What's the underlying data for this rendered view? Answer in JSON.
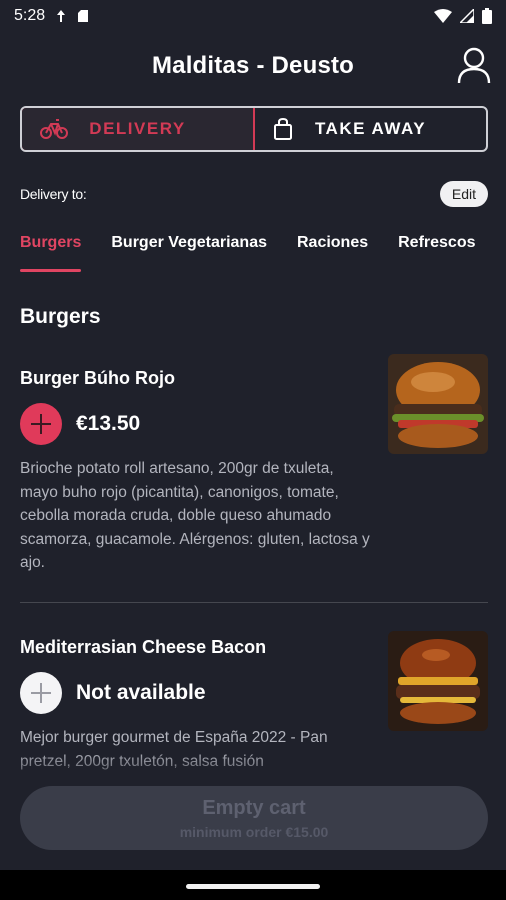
{
  "status": {
    "time": "5:28"
  },
  "header": {
    "title": "Malditas - Deusto"
  },
  "mode_toggle": {
    "delivery_label": "DELIVERY",
    "takeaway_label": "TAKE AWAY"
  },
  "delivery": {
    "label": "Delivery to:",
    "edit_label": "Edit"
  },
  "tabs": [
    {
      "label": "Burgers",
      "active": true
    },
    {
      "label": "Burger Vegetarianas",
      "active": false
    },
    {
      "label": "Raciones",
      "active": false
    },
    {
      "label": "Refrescos",
      "active": false
    }
  ],
  "section": {
    "title": "Burgers"
  },
  "items": [
    {
      "name": "Burger Búho Rojo",
      "price": "€13.50",
      "description": "Brioche potato roll artesano, 200gr de txuleta, mayo buho rojo (picantita), canonigos, tomate, cebolla morada cruda, doble queso ahumado scamorza, guacamole. Alérgenos: gluten, lactosa y ajo."
    },
    {
      "name": "Mediterrasian Cheese Bacon",
      "price": "Not available",
      "description": "Mejor burger gourmet de España 2022 - Pan pretzel, 200gr txuletón, salsa fusión"
    }
  ],
  "cart": {
    "title": "Empty cart",
    "subtitle": "minimum order €15.00"
  },
  "colors": {
    "accent": "#e03a5a",
    "background": "#1f212b"
  }
}
